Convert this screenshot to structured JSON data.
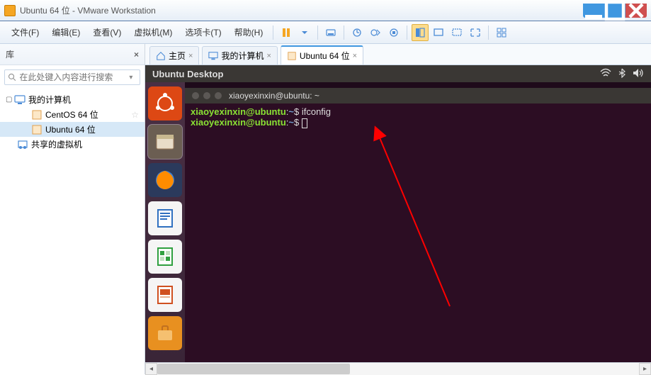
{
  "window": {
    "title": "Ubuntu 64 位 - VMware Workstation"
  },
  "menu": {
    "file": "文件(F)",
    "edit": "编辑(E)",
    "view": "查看(V)",
    "vm": "虚拟机(M)",
    "tabs": "选项卡(T)",
    "help": "帮助(H)"
  },
  "sidebar": {
    "header": "库",
    "search_placeholder": "在此处键入内容进行搜索",
    "tree": {
      "root": "我的计算机",
      "vm1": "CentOS 64 位",
      "vm2": "Ubuntu 64 位",
      "shared": "共享的虚拟机"
    }
  },
  "tabs": {
    "home": "主页",
    "computer": "我的计算机",
    "ubuntu": "Ubuntu 64 位"
  },
  "guest": {
    "desktop_title": "Ubuntu Desktop",
    "term_title": "xiaoyexinxin@ubuntu: ~",
    "lines": [
      {
        "user": "xiaoyexinxin",
        "at": "@",
        "host": "ubuntu",
        "colon": ":",
        "path": "~",
        "prompt": "$ ",
        "cmd": "ifconfig"
      },
      {
        "user": "xiaoyexinxin",
        "at": "@",
        "host": "ubuntu",
        "colon": ":",
        "path": "~",
        "prompt": "$ ",
        "cmd": ""
      }
    ]
  }
}
